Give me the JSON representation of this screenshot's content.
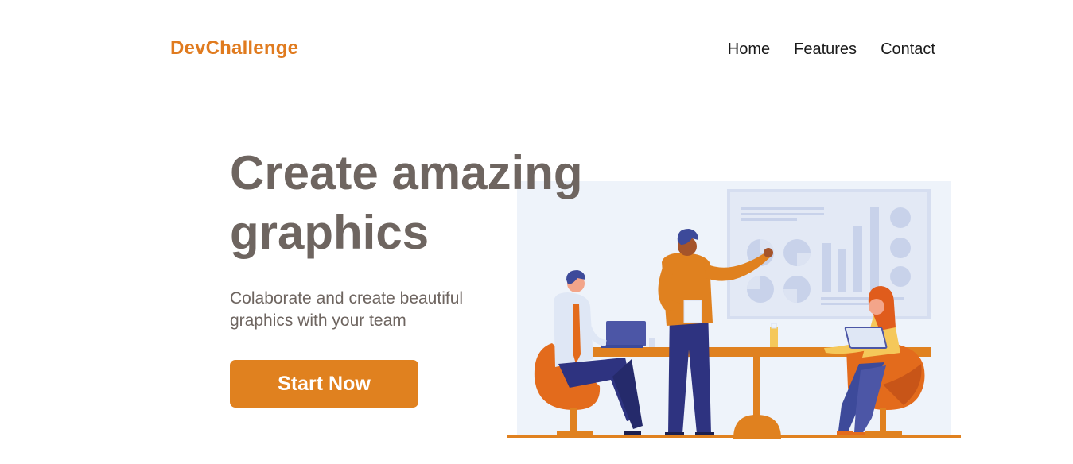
{
  "header": {
    "logo": "DevChallenge",
    "nav": [
      {
        "label": "Home"
      },
      {
        "label": "Features"
      },
      {
        "label": "Contact"
      }
    ]
  },
  "hero": {
    "title": "Create amazing graphics",
    "subtitle": "Colaborate and create beautiful graphics with your team",
    "cta_label": "Start Now"
  },
  "colors": {
    "accent": "#e0811f",
    "text": "#6e6560",
    "illustration_bg": "#eef3fa"
  }
}
